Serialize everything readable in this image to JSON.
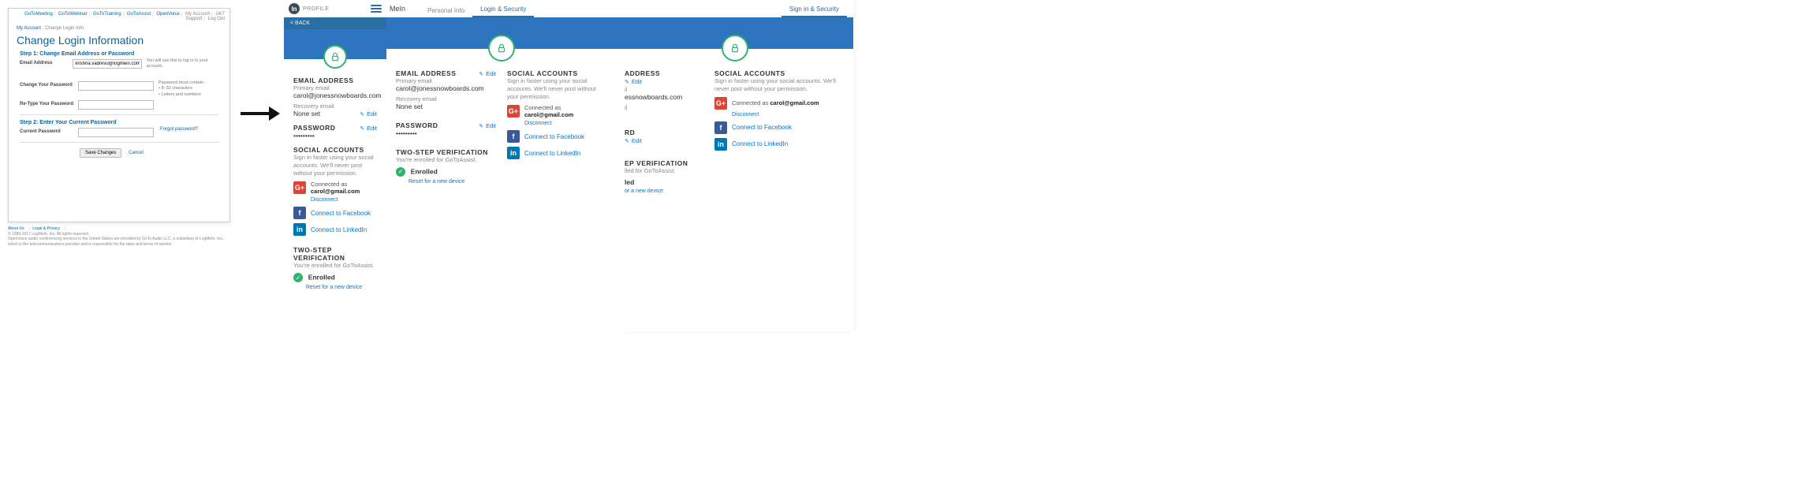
{
  "old": {
    "topnav": [
      "GoToMeeting",
      "GoToWebinar",
      "GoToTraining",
      "GoToAssist",
      "OpenVoice"
    ],
    "topnav_right": [
      "My Account",
      "24/7 Support",
      "Log Out"
    ],
    "crumbs": {
      "a": "My Account",
      "b": "Change Login Info"
    },
    "title": "Change Login Information",
    "step1": "Step 1: Change Email Address or Password",
    "email_label": "Email Address",
    "email_value": "krishna.vadrevu@logmein.com",
    "email_help": "You will use this to log in to your account.",
    "change_pw_label": "Change Your Password",
    "pw_rules_head": "Password must contain:",
    "pw_rule1": "• 8–32 characters",
    "pw_rule2": "• Letters and numbers",
    "retype_label": "Re-Type Your Password",
    "step2": "Step 2: Enter Your Current Password",
    "current_pw_label": "Current Password",
    "forgot": "Forgot password?",
    "save": "Save Changes",
    "cancel": "Cancel",
    "footer_links": [
      "About Us",
      "Legal & Privacy"
    ],
    "copyright": "© 1999-2017 LogMeIn, Inc. All rights reserved.",
    "legal": "OpenVoice audio conferencing services in the United States are provided by GoTo Audio LLC, a subsidiary of LogMeIn, Inc., which is the telecommunications provider and is responsible for the rates and terms of service."
  },
  "prof": {
    "brand": "PROFILE",
    "back": "< BACK",
    "email_h": "EMAIL ADDRESS",
    "primary_l": "Primary email",
    "primary_v": "carol@jonessnowboards.com",
    "recovery_l": "Recovery email",
    "recovery_v": "None set",
    "edit": "Edit",
    "password_h": "PASSWORD",
    "password_v": "•••••••••",
    "social_h": "SOCIAL ACCOUNTS",
    "social_desc": "Sign in faster using your social accounts. We'll never post without your permission.",
    "g_connected_prefix": "Connected as ",
    "g_connected_email": "carol@gmail.com",
    "disconnect": "Disconnect",
    "fb": "Connect to Facebook",
    "li": "Connect to LinkedIn",
    "twostep_h": "TWO-STEP VERIFICATION",
    "twostep_desc": "You're enrolled for GoToAssist.",
    "enrolled": "Enrolled",
    "reset": "Reset for a new device"
  },
  "tabs": {
    "personal": "Personal Info",
    "login": "Login & Security",
    "signin": "Sign in & Security",
    "mein": "MeIn"
  },
  "clipped": {
    "address": "ADDRESS",
    "email_suffix": "essnowboards.com",
    "il": "il",
    "rd": "RD",
    "step_ver": "EP VERIFICATION",
    "enrolled_for": "lled for GoToAssist.",
    "led": "led",
    "reset_tail": "or a new device"
  }
}
